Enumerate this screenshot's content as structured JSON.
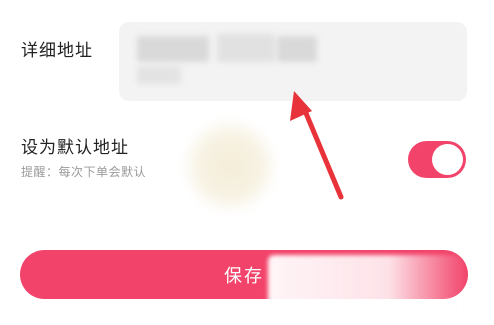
{
  "address": {
    "label": "详细地址"
  },
  "default_address": {
    "label": "设为默认地址",
    "hint": "提醒：每次下单会默认",
    "toggle_on": true
  },
  "save_button": {
    "label": "保存"
  },
  "colors": {
    "accent": "#f2436a",
    "field_background": "#f3f3f3",
    "annotation_arrow": "#e8333a"
  },
  "icons": {
    "annotation": "red-arrow-icon"
  }
}
